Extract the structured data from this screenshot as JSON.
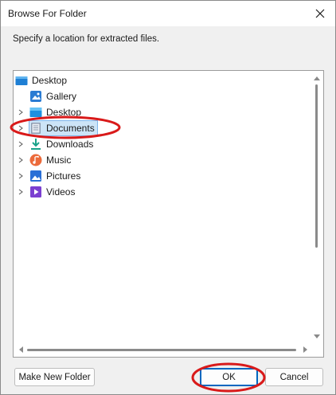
{
  "window": {
    "title": "Browse For Folder"
  },
  "instruction": "Specify a location for extracted files.",
  "tree": {
    "root": {
      "label": "Desktop",
      "icon": "desktop-folder-icon"
    },
    "items": [
      {
        "label": "Gallery",
        "icon": "gallery-icon",
        "expandable": false
      },
      {
        "label": "Desktop",
        "icon": "desktop-icon",
        "expandable": true
      },
      {
        "label": "Documents",
        "icon": "documents-icon",
        "expandable": true,
        "selected": true
      },
      {
        "label": "Downloads",
        "icon": "downloads-icon",
        "expandable": true
      },
      {
        "label": "Music",
        "icon": "music-icon",
        "expandable": true
      },
      {
        "label": "Pictures",
        "icon": "pictures-icon",
        "expandable": true
      },
      {
        "label": "Videos",
        "icon": "videos-icon",
        "expandable": true
      }
    ]
  },
  "buttons": {
    "new_folder": "Make New Folder",
    "ok": "OK",
    "cancel": "Cancel"
  },
  "colors": {
    "selection_bg": "#cce4f7",
    "selection_border": "#7eb4ea",
    "accent": "#0067c0",
    "annotation": "#d91a1a"
  }
}
